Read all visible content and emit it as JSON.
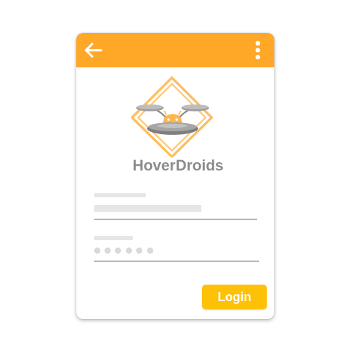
{
  "app": {
    "name": "HoverDroids"
  },
  "toolbar": {
    "back_icon": "arrow-left-icon",
    "menu_icon": "more-vert-icon"
  },
  "login": {
    "button_label": "Login"
  },
  "colors": {
    "appbar": "#FFA726",
    "accent": "#FFC107",
    "logo_frame": "#FFB74D",
    "android": "#FFB74D",
    "drone": "#8A8A8A",
    "title": "#8C8C8C",
    "placeholder": "#E6E6E6",
    "field_line": "#B5B5B5"
  }
}
